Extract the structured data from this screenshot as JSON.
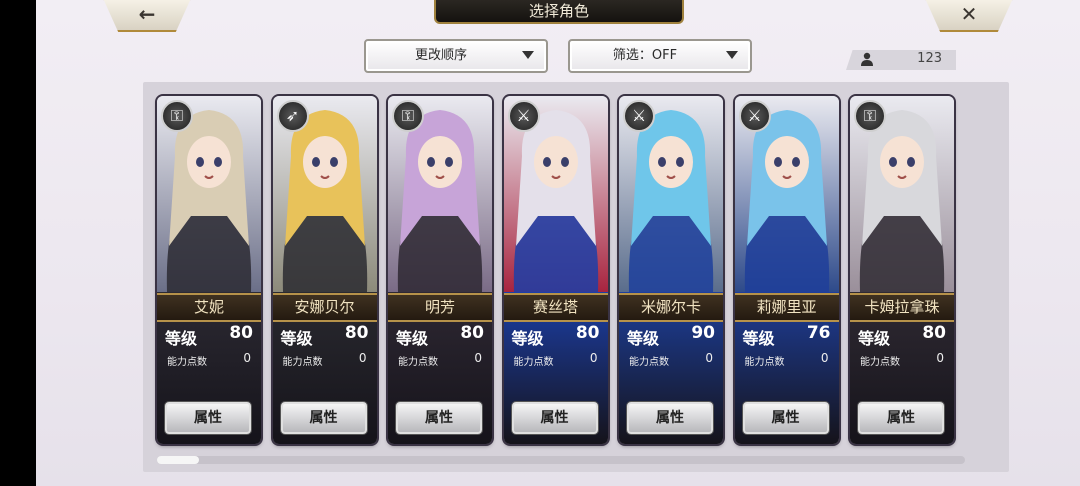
{
  "header": {
    "title": "选择角色",
    "back_icon": "arrow-left",
    "close_icon": "x"
  },
  "sort": {
    "label": "更改顺序"
  },
  "filter": {
    "label": "筛选：OFF"
  },
  "count": {
    "value": "123",
    "icon": "person"
  },
  "cards": [
    {
      "name": "艾妮",
      "level_label": "等级",
      "level": "80",
      "ap_label": "能力点数",
      "ap": "0",
      "button": "属性",
      "type_icon": "key",
      "hair": "#d9cdb4",
      "bg": "#6b6f88",
      "lower": "#2c2a33"
    },
    {
      "name": "安娜贝尔",
      "level_label": "等级",
      "level": "80",
      "ap_label": "能力点数",
      "ap": "0",
      "button": "属性",
      "type_icon": "arrow",
      "hair": "#e8c25a",
      "bg": "#8c8a7a",
      "lower": "#2a2a30"
    },
    {
      "name": "明芳",
      "level_label": "等级",
      "level": "80",
      "ap_label": "能力点数",
      "ap": "0",
      "button": "属性",
      "type_icon": "key",
      "hair": "#c7a4d8",
      "bg": "#7a6b86",
      "lower": "#2e2833"
    },
    {
      "name": "赛丝塔",
      "level_label": "等级",
      "level": "80",
      "ap_label": "能力点数",
      "ap": "0",
      "button": "属性",
      "type_icon": "sword",
      "hair": "#e4e0ea",
      "bg": "#a8243f",
      "lower": "#1c3fa8"
    },
    {
      "name": "米娜尔卡",
      "level_label": "等级",
      "level": "90",
      "ap_label": "能力点数",
      "ap": "0",
      "button": "属性",
      "type_icon": "sword",
      "hair": "#6fc6ea",
      "bg": "#5a6d8c",
      "lower": "#1d3f9c"
    },
    {
      "name": "莉娜里亚",
      "level_label": "等级",
      "level": "76",
      "ap_label": "能力点数",
      "ap": "0",
      "button": "属性",
      "type_icon": "sword",
      "hair": "#7ac3ea",
      "bg": "#2e4a8a",
      "lower": "#1e3e9a"
    },
    {
      "name": "卡姆拉拿珠",
      "level_label": "等级",
      "level": "80",
      "ap_label": "能力点数",
      "ap": "0",
      "button": "属性",
      "type_icon": "key",
      "hair": "#d8d8dc",
      "bg": "#9a8f9a",
      "lower": "#2f2a33"
    }
  ]
}
